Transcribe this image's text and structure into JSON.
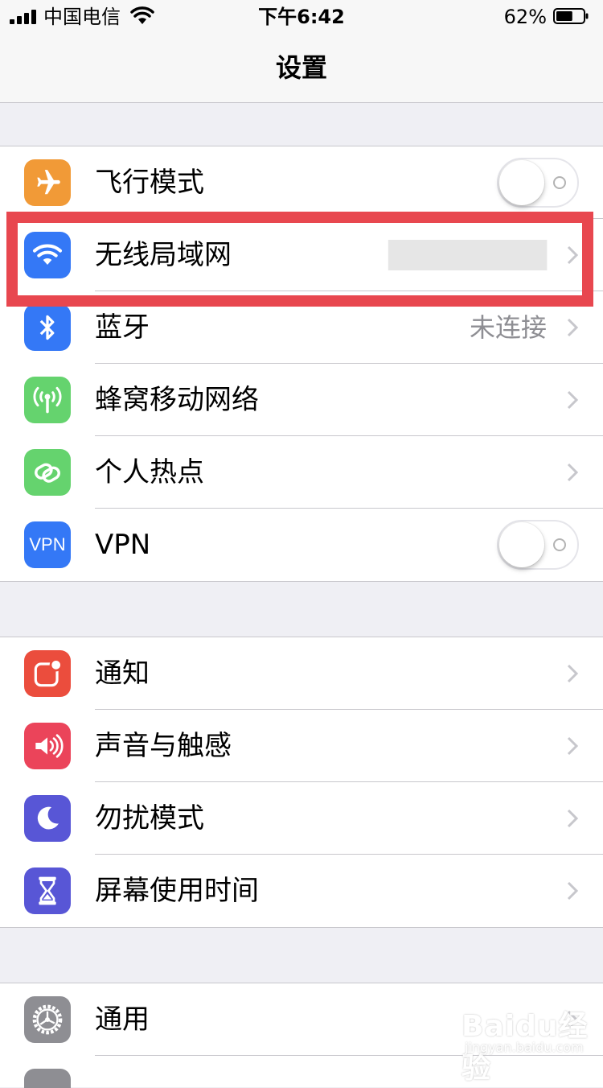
{
  "status_bar": {
    "carrier": "中国电信",
    "time": "下午6:42",
    "battery_percent": "62%",
    "battery_level": 0.62
  },
  "nav": {
    "title": "设置"
  },
  "groups": [
    {
      "rows": [
        {
          "label": "飞行模式",
          "icon": "airplane-icon",
          "icon_color": "#f19a37",
          "accessory": "toggle",
          "toggle_on": false
        },
        {
          "label": "无线局域网",
          "icon": "wifi-icon",
          "icon_color": "#3478f6",
          "accessory": "chevron",
          "value": "(obscured)"
        },
        {
          "label": "蓝牙",
          "icon": "bluetooth-icon",
          "icon_color": "#3478f6",
          "accessory": "chevron",
          "value": "未连接"
        },
        {
          "label": "蜂窝移动网络",
          "icon": "cellular-antenna-icon",
          "icon_color": "#65d36e",
          "accessory": "chevron"
        },
        {
          "label": "个人热点",
          "icon": "hotspot-link-icon",
          "icon_color": "#65d36e",
          "accessory": "chevron"
        },
        {
          "label": "VPN",
          "icon": "vpn-icon",
          "icon_text": "VPN",
          "icon_color": "#3478f6",
          "accessory": "toggle",
          "toggle_on": false
        }
      ]
    },
    {
      "rows": [
        {
          "label": "通知",
          "icon": "notifications-icon",
          "icon_color": "#eb4d3d",
          "accessory": "chevron"
        },
        {
          "label": "声音与触感",
          "icon": "speaker-icon",
          "icon_color": "#eb445a",
          "accessory": "chevron"
        },
        {
          "label": "勿扰模式",
          "icon": "moon-icon",
          "icon_color": "#5856d6",
          "accessory": "chevron"
        },
        {
          "label": "屏幕使用时间",
          "icon": "hourglass-icon",
          "icon_color": "#5856d6",
          "accessory": "chevron"
        }
      ]
    },
    {
      "rows": [
        {
          "label": "通用",
          "icon": "gear-icon",
          "icon_color": "#8e8e93",
          "accessory": "chevron"
        }
      ]
    }
  ],
  "watermark": {
    "brand": "Baidu经验",
    "url": "jingyan.baidu.com"
  },
  "colors": {
    "highlight_box": "#e8474f",
    "separator": "#c8c7cc",
    "background": "#efeff4"
  }
}
